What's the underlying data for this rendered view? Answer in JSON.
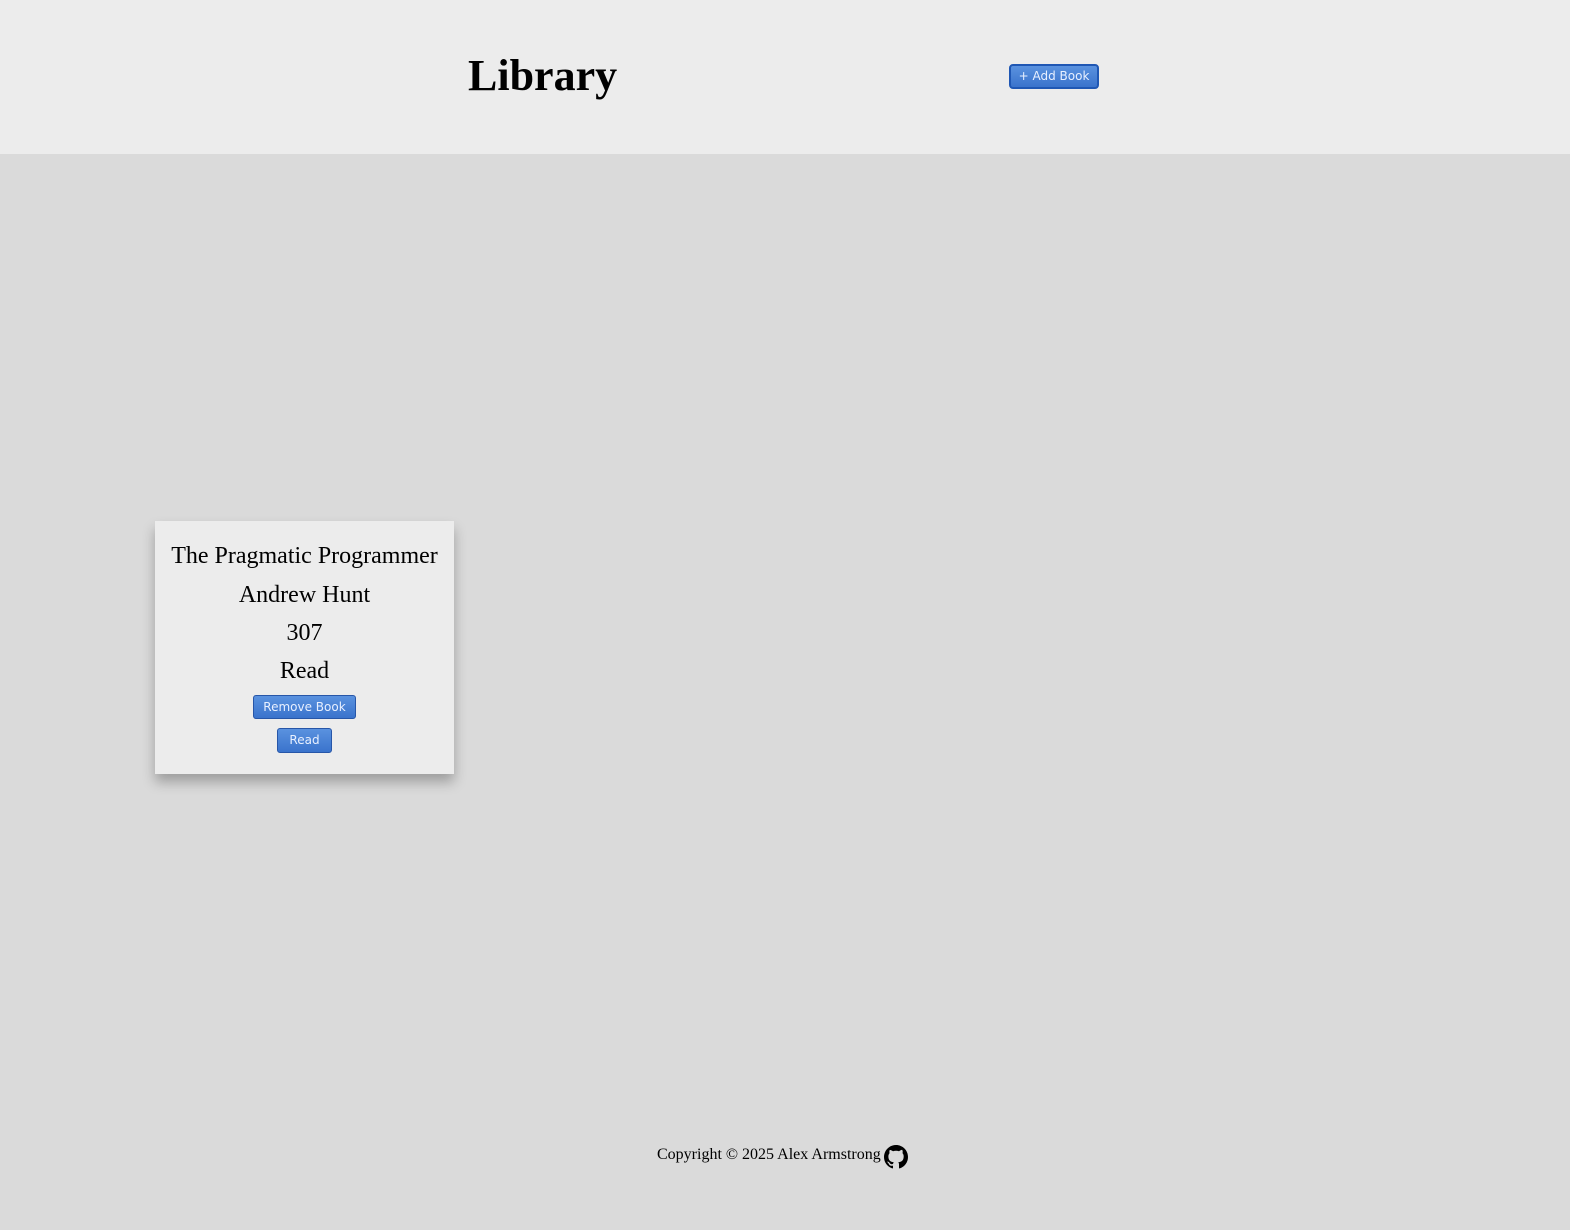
{
  "header": {
    "title": "Library",
    "add_button_label": "+ Add Book"
  },
  "books": [
    {
      "title": "The Pragmatic Programmer",
      "author": "Andrew Hunt",
      "pages": "307",
      "status": "Read",
      "remove_label": "Remove Book",
      "toggle_label": "Read"
    }
  ],
  "footer": {
    "copyright": "Copyright © 2025 Alex Armstrong",
    "icon": "github-icon"
  },
  "colors": {
    "header_bg": "#ececec",
    "page_bg": "#dadada",
    "button_blue": "#3a73cc"
  }
}
